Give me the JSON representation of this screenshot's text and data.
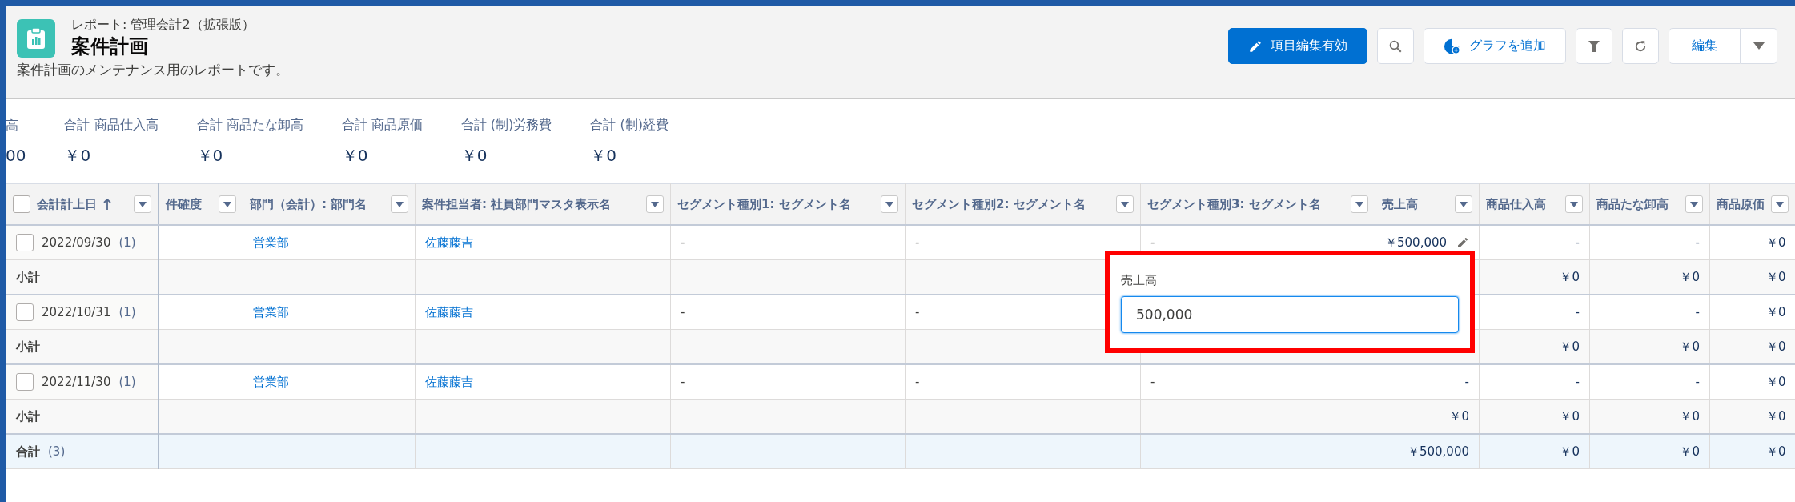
{
  "header": {
    "breadcrumb": "レポート: 管理会計2（拡張版）",
    "title": "案件計画",
    "description": "案件計画のメンテナンス用のレポートです。"
  },
  "actions": [
    {
      "kind": "primary",
      "label": "項目編集有効"
    },
    {
      "kind": "search"
    },
    {
      "kind": "chart",
      "label": "グラフを追加"
    },
    {
      "kind": "filter"
    },
    {
      "kind": "refresh"
    },
    {
      "kind": "split",
      "label": "編集"
    }
  ],
  "summary": [
    {
      "label": "高",
      "value": "00"
    },
    {
      "label": "合計 商品仕入高",
      "value": "￥0"
    },
    {
      "label": "合計 商品たな卸高",
      "value": "￥0"
    },
    {
      "label": "合計 商品原価",
      "value": "￥0"
    },
    {
      "label": "合計 (制)労務費",
      "value": "￥0"
    },
    {
      "label": "合計 (制)経費",
      "value": "￥0"
    }
  ],
  "table": {
    "select_all": {
      "checked": false
    },
    "columns": [
      {
        "label": "会計計上日",
        "kind": "date",
        "sorted": true
      },
      {
        "label": "件確度",
        "kind": "text",
        "sorted": false
      },
      {
        "label": "部門（会計）: 部門名",
        "kind": "link",
        "sorted": false
      },
      {
        "label": "案件担当者: 社員部門マスタ表示名",
        "kind": "link",
        "sorted": false
      },
      {
        "label": "セグメント種別1: セグメント名",
        "kind": "text",
        "sorted": false
      },
      {
        "label": "セグメント種別2: セグメント名",
        "kind": "text",
        "sorted": false
      },
      {
        "label": "セグメント種別3: セグメント名",
        "kind": "text",
        "sorted": false
      },
      {
        "label": "売上高",
        "kind": "money",
        "sorted": false
      },
      {
        "label": "商品仕入高",
        "kind": "money",
        "sorted": false
      },
      {
        "label": "商品たな卸高",
        "kind": "money",
        "sorted": false
      },
      {
        "label": "商品原価",
        "kind": "money",
        "sorted": false
      }
    ],
    "rows": [
      {
        "kind": "detail",
        "checked": false,
        "count": "(1)",
        "editable": true,
        "cells": [
          "2022/09/30",
          "",
          "営業部",
          "佐藤藤吉",
          "-",
          "-",
          "-",
          "￥500,000",
          "-",
          "-",
          "￥0"
        ]
      },
      {
        "kind": "subtotal",
        "editable": false,
        "cells": [
          "小計",
          "",
          "",
          "",
          "",
          "",
          "",
          "",
          "￥0",
          "￥0",
          "￥0"
        ]
      },
      {
        "kind": "detail",
        "checked": false,
        "count": "(1)",
        "editable": false,
        "cells": [
          "2022/10/31",
          "",
          "営業部",
          "佐藤藤吉",
          "-",
          "-",
          "",
          "",
          "-",
          "-",
          "￥0"
        ]
      },
      {
        "kind": "subtotal",
        "editable": false,
        "cells": [
          "小計",
          "",
          "",
          "",
          "",
          "",
          "",
          "",
          "￥0",
          "￥0",
          "￥0"
        ]
      },
      {
        "kind": "detail",
        "checked": false,
        "count": "(1)",
        "editable": false,
        "cells": [
          "2022/11/30",
          "",
          "営業部",
          "佐藤藤吉",
          "-",
          "-",
          "-",
          "-",
          "-",
          "-",
          "￥0"
        ]
      },
      {
        "kind": "subtotal",
        "editable": false,
        "cells": [
          "小計",
          "",
          "",
          "",
          "",
          "",
          "",
          "￥0",
          "￥0",
          "￥0",
          "￥0"
        ]
      },
      {
        "kind": "total",
        "count": "(3)",
        "editable": false,
        "cells": [
          "合計",
          "",
          "",
          "",
          "",
          "",
          "",
          "￥500,000",
          "￥0",
          "￥0",
          "￥0"
        ]
      }
    ]
  },
  "inline_editor": {
    "label": "売上高",
    "value": "500,000",
    "highlighted": true
  }
}
